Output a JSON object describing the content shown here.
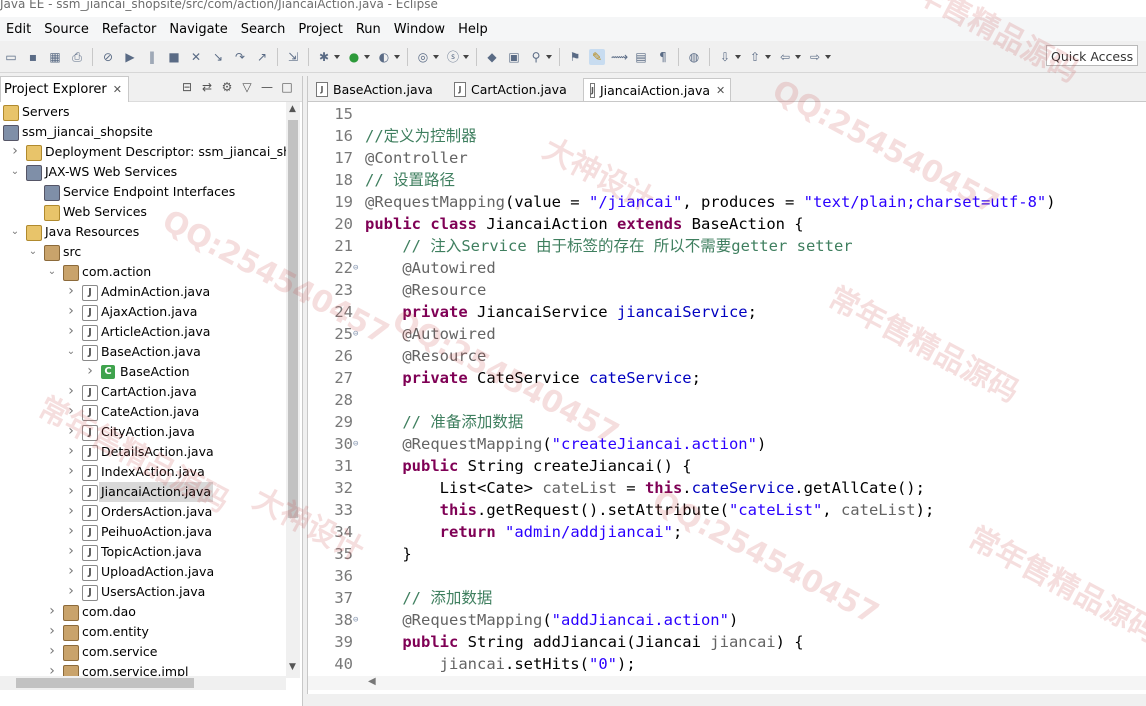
{
  "window": {
    "title": "Java EE - ssm_jiancai_shopsite/src/com/action/JiancaiAction.java - Eclipse"
  },
  "menu": [
    "Edit",
    "Source",
    "Refactor",
    "Navigate",
    "Search",
    "Project",
    "Run",
    "Window",
    "Help"
  ],
  "toolbar": {
    "quick_access": "Quick Access"
  },
  "explorer": {
    "title": "Project Explorer",
    "items": [
      {
        "label": "Servers",
        "icon": "folder-icon",
        "depth": 0,
        "arrow": ""
      },
      {
        "label": "ssm_jiancai_shopsite",
        "icon": "project-icon",
        "depth": 0,
        "arrow": ""
      },
      {
        "label": "Deployment Descriptor: ssm_jiancai_shop",
        "icon": "descriptor-icon",
        "depth": 1,
        "arrow": "right"
      },
      {
        "label": "JAX-WS Web Services",
        "icon": "webservices-icon",
        "depth": 1,
        "arrow": "down"
      },
      {
        "label": "Service Endpoint Interfaces",
        "icon": "endpoint-icon",
        "depth": 2,
        "arrow": ""
      },
      {
        "label": "Web Services",
        "icon": "webservice-icon",
        "depth": 2,
        "arrow": ""
      },
      {
        "label": "Java Resources",
        "icon": "java-resources-icon",
        "depth": 1,
        "arrow": "down"
      },
      {
        "label": "src",
        "icon": "source-folder-icon",
        "depth": 2,
        "arrow": "down"
      },
      {
        "label": "com.action",
        "icon": "package-icon",
        "depth": 3,
        "arrow": "down"
      },
      {
        "label": "AdminAction.java",
        "icon": "java-file-icon",
        "depth": 4,
        "arrow": "right"
      },
      {
        "label": "AjaxAction.java",
        "icon": "java-file-icon",
        "depth": 4,
        "arrow": "right"
      },
      {
        "label": "ArticleAction.java",
        "icon": "java-file-icon",
        "depth": 4,
        "arrow": "right"
      },
      {
        "label": "BaseAction.java",
        "icon": "java-file-icon",
        "depth": 4,
        "arrow": "down"
      },
      {
        "label": "BaseAction",
        "icon": "class-icon",
        "depth": 5,
        "arrow": "right"
      },
      {
        "label": "CartAction.java",
        "icon": "java-file-icon",
        "depth": 4,
        "arrow": "right"
      },
      {
        "label": "CateAction.java",
        "icon": "java-file-icon",
        "depth": 4,
        "arrow": "right"
      },
      {
        "label": "CityAction.java",
        "icon": "java-file-icon",
        "depth": 4,
        "arrow": "right"
      },
      {
        "label": "DetailsAction.java",
        "icon": "java-file-icon",
        "depth": 4,
        "arrow": "right"
      },
      {
        "label": "IndexAction.java",
        "icon": "java-file-icon",
        "depth": 4,
        "arrow": "right"
      },
      {
        "label": "JiancaiAction.java",
        "icon": "java-file-icon",
        "depth": 4,
        "arrow": "right",
        "selected": true
      },
      {
        "label": "OrdersAction.java",
        "icon": "java-file-icon",
        "depth": 4,
        "arrow": "right"
      },
      {
        "label": "PeihuoAction.java",
        "icon": "java-file-icon",
        "depth": 4,
        "arrow": "right"
      },
      {
        "label": "TopicAction.java",
        "icon": "java-file-icon",
        "depth": 4,
        "arrow": "right"
      },
      {
        "label": "UploadAction.java",
        "icon": "java-file-icon",
        "depth": 4,
        "arrow": "right"
      },
      {
        "label": "UsersAction.java",
        "icon": "java-file-icon",
        "depth": 4,
        "arrow": "right"
      },
      {
        "label": "com.dao",
        "icon": "package-icon",
        "depth": 3,
        "arrow": "right"
      },
      {
        "label": "com.entity",
        "icon": "package-icon",
        "depth": 3,
        "arrow": "right"
      },
      {
        "label": "com.service",
        "icon": "package-icon",
        "depth": 3,
        "arrow": "right"
      },
      {
        "label": "com.service.impl",
        "icon": "package-icon",
        "depth": 3,
        "arrow": "right"
      }
    ]
  },
  "editor": {
    "tabs": [
      {
        "label": "BaseAction.java",
        "active": false
      },
      {
        "label": "CartAction.java",
        "active": false
      },
      {
        "label": "JiancaiAction.java",
        "active": true
      }
    ],
    "lines": [
      {
        "n": "15",
        "fold": false,
        "tokens": []
      },
      {
        "n": "16",
        "fold": false,
        "tokens": [
          [
            "cm",
            "//定义为控制器"
          ]
        ]
      },
      {
        "n": "17",
        "fold": false,
        "tokens": [
          [
            "ann",
            "@Controller"
          ]
        ]
      },
      {
        "n": "18",
        "fold": false,
        "tokens": [
          [
            "cm",
            "// 设置路径"
          ]
        ]
      },
      {
        "n": "19",
        "fold": false,
        "tokens": [
          [
            "ann",
            "@RequestMapping"
          ],
          [
            "p",
            "(value = "
          ],
          [
            "str",
            "\"/jiancai\""
          ],
          [
            "p",
            ", produces = "
          ],
          [
            "str",
            "\"text/plain;charset=utf-8\""
          ],
          [
            "p",
            ")"
          ]
        ]
      },
      {
        "n": "20",
        "fold": false,
        "tokens": [
          [
            "kw",
            "public"
          ],
          [
            "p",
            " "
          ],
          [
            "kw",
            "class"
          ],
          [
            "p",
            " JiancaiAction "
          ],
          [
            "kw",
            "extends"
          ],
          [
            "p",
            " BaseAction {"
          ]
        ]
      },
      {
        "n": "21",
        "fold": false,
        "tokens": [
          [
            "p",
            "    "
          ],
          [
            "cm",
            "// 注入Service 由于标签的存在 所以不需要getter setter"
          ]
        ]
      },
      {
        "n": "22",
        "fold": true,
        "tokens": [
          [
            "p",
            "    "
          ],
          [
            "ann",
            "@Autowired"
          ]
        ]
      },
      {
        "n": "23",
        "fold": false,
        "tokens": [
          [
            "p",
            "    "
          ],
          [
            "ann",
            "@Resource"
          ]
        ]
      },
      {
        "n": "24",
        "fold": false,
        "tokens": [
          [
            "p",
            "    "
          ],
          [
            "kw",
            "private"
          ],
          [
            "p",
            " JiancaiService "
          ],
          [
            "fld",
            "jiancaiService"
          ],
          [
            "p",
            ";"
          ]
        ]
      },
      {
        "n": "25",
        "fold": true,
        "tokens": [
          [
            "p",
            "    "
          ],
          [
            "ann",
            "@Autowired"
          ]
        ]
      },
      {
        "n": "26",
        "fold": false,
        "tokens": [
          [
            "p",
            "    "
          ],
          [
            "ann",
            "@Resource"
          ]
        ]
      },
      {
        "n": "27",
        "fold": false,
        "tokens": [
          [
            "p",
            "    "
          ],
          [
            "kw",
            "private"
          ],
          [
            "p",
            " CateService "
          ],
          [
            "fld",
            "cateService"
          ],
          [
            "p",
            ";"
          ]
        ]
      },
      {
        "n": "28",
        "fold": false,
        "tokens": []
      },
      {
        "n": "29",
        "fold": false,
        "tokens": [
          [
            "p",
            "    "
          ],
          [
            "cm",
            "// 准备添加数据"
          ]
        ]
      },
      {
        "n": "30",
        "fold": true,
        "tokens": [
          [
            "p",
            "    "
          ],
          [
            "ann",
            "@RequestMapping"
          ],
          [
            "p",
            "("
          ],
          [
            "str",
            "\"createJiancai.action\""
          ],
          [
            "p",
            ")"
          ]
        ]
      },
      {
        "n": "31",
        "fold": false,
        "tokens": [
          [
            "p",
            "    "
          ],
          [
            "kw",
            "public"
          ],
          [
            "p",
            " String createJiancai() {"
          ]
        ]
      },
      {
        "n": "32",
        "fold": false,
        "tokens": [
          [
            "p",
            "        List<Cate> "
          ],
          [
            "ann",
            "cateList"
          ],
          [
            "p",
            " = "
          ],
          [
            "kw",
            "this"
          ],
          [
            "p",
            "."
          ],
          [
            "fld",
            "cateService"
          ],
          [
            "p",
            ".getAllCate();"
          ]
        ]
      },
      {
        "n": "33",
        "fold": false,
        "tokens": [
          [
            "p",
            "        "
          ],
          [
            "kw",
            "this"
          ],
          [
            "p",
            ".getRequest().setAttribute("
          ],
          [
            "str",
            "\"cateList\""
          ],
          [
            "p",
            ", "
          ],
          [
            "ann",
            "cateList"
          ],
          [
            "p",
            ");"
          ]
        ]
      },
      {
        "n": "34",
        "fold": false,
        "tokens": [
          [
            "p",
            "        "
          ],
          [
            "kw",
            "return"
          ],
          [
            "p",
            " "
          ],
          [
            "str",
            "\"admin/addjiancai\""
          ],
          [
            "p",
            ";"
          ]
        ]
      },
      {
        "n": "35",
        "fold": false,
        "tokens": [
          [
            "p",
            "    }"
          ]
        ]
      },
      {
        "n": "36",
        "fold": false,
        "tokens": []
      },
      {
        "n": "37",
        "fold": false,
        "tokens": [
          [
            "p",
            "    "
          ],
          [
            "cm",
            "// 添加数据"
          ]
        ]
      },
      {
        "n": "38",
        "fold": true,
        "tokens": [
          [
            "p",
            "    "
          ],
          [
            "ann",
            "@RequestMapping"
          ],
          [
            "p",
            "("
          ],
          [
            "str",
            "\"addJiancai.action\""
          ],
          [
            "p",
            ")"
          ]
        ]
      },
      {
        "n": "39",
        "fold": false,
        "tokens": [
          [
            "p",
            "    "
          ],
          [
            "kw",
            "public"
          ],
          [
            "p",
            " String addJiancai(Jiancai "
          ],
          [
            "ann",
            "jiancai"
          ],
          [
            "p",
            ") {"
          ]
        ]
      },
      {
        "n": "40",
        "fold": false,
        "tokens": [
          [
            "p",
            "        "
          ],
          [
            "ann",
            "jiancai"
          ],
          [
            "p",
            ".setHits("
          ],
          [
            "str",
            "\"0\""
          ],
          [
            "p",
            ");"
          ]
        ]
      }
    ]
  },
  "watermarks": [
    "常年售精品源码",
    "QQ:254540457",
    "大神设计",
    "常年售精品源码",
    "QQ:254540457",
    "大神设计",
    "QQ:254540457",
    "常年售精品源码",
    "QQ:254540457",
    "常年售精品源码"
  ]
}
